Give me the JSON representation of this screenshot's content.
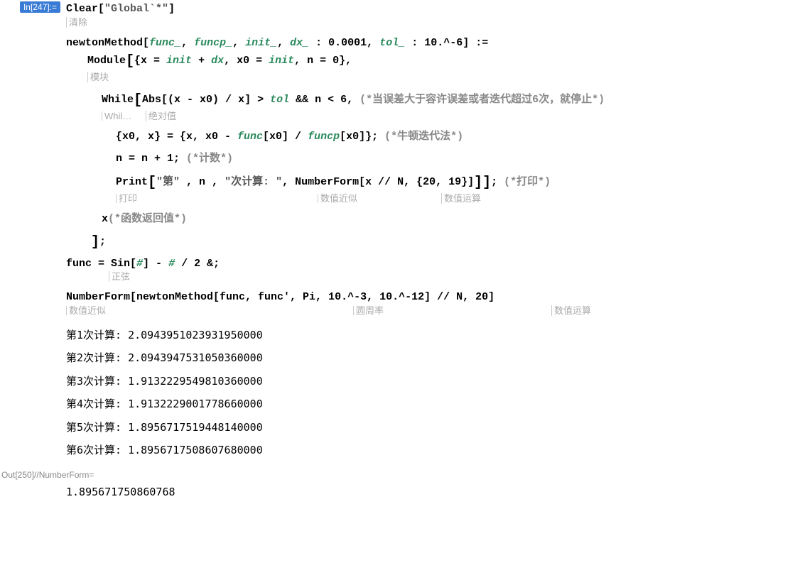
{
  "inLabel": "In[247]:=",
  "outLabel": "Out[250]//NumberForm=",
  "clear": {
    "fn": "Clear",
    "arg": "\"Global`*\"",
    "hint": "清除"
  },
  "def": {
    "head": "newtonMethod",
    "p1": "func_",
    "p2": "funcp_",
    "p3": "init_",
    "p4": "dx_",
    "p4d": " : 0.0001",
    "p5": "tol_",
    "p5d": " : 10.^-6",
    "assign": ":="
  },
  "module": {
    "kw": "Module",
    "open": "[",
    "locals_a": "{x = ",
    "l_init": "init",
    "plus": " + ",
    "l_dx": "dx",
    "locals_b": ", x0 = ",
    "l_init2": "init",
    "locals_c": ", n = 0},",
    "hint": "模块"
  },
  "while": {
    "kw": "While",
    "open": "[",
    "abs": "Abs",
    "absHint": "绝对值",
    "cond1a": "[(x - x0) / x] > ",
    "tol": "tol",
    "cond1b": " && n < 6, ",
    "comment": "(*当误差大于容许误差或者迭代超过6次，就停止*)",
    "whilHint": "Whil…"
  },
  "body1": {
    "txt": "{x0, x} = {x, x0 - ",
    "func": "func",
    "mid": "[x0] / ",
    "funcp": "funcp",
    "end": "[x0]}; ",
    "comment": "(*牛顿迭代法*)"
  },
  "body2": {
    "txt": "n = n + 1; ",
    "comment": "(*计数*)"
  },
  "body3": {
    "print": "Print",
    "open": "[",
    "s1": "\"第\"",
    "s2": " , n , ",
    "s3": "\"次计算: \"",
    "s4": ", ",
    "nf": "NumberForm",
    "nfarg": "[x // N, {20, 19}]",
    "close": "]]; ",
    "comment": "(*打印*)",
    "printHint": "打印",
    "nfHint": "数值近似",
    "nHint": "数值运算"
  },
  "ret": {
    "txt": "x",
    "comment": "(*函数返回值*)"
  },
  "close": "];",
  "funcdef": {
    "a": "func = Sin[",
    "hash": "#",
    "b": "] - ",
    "hash2": "#",
    "c": " / 2 &;",
    "sinHint": "正弦"
  },
  "call": {
    "nf": "NumberForm",
    "open": "[newtonMethod[func, func', Pi, 10.^-3, 10.^-12] // N, 20]",
    "nfHint": "数值近似",
    "piHint": "圆周率",
    "nHint": "数值运算"
  },
  "outputs": [
    "第1次计算: 2.0943951023931950000",
    "第2次计算: 2.0943947531050360000",
    "第3次计算: 1.9132229549810360000",
    "第4次计算: 1.9132229001778660000",
    "第5次计算: 1.8956717519448140000",
    "第6次计算: 1.8956717508607680000"
  ],
  "result": "1.895671750860768"
}
